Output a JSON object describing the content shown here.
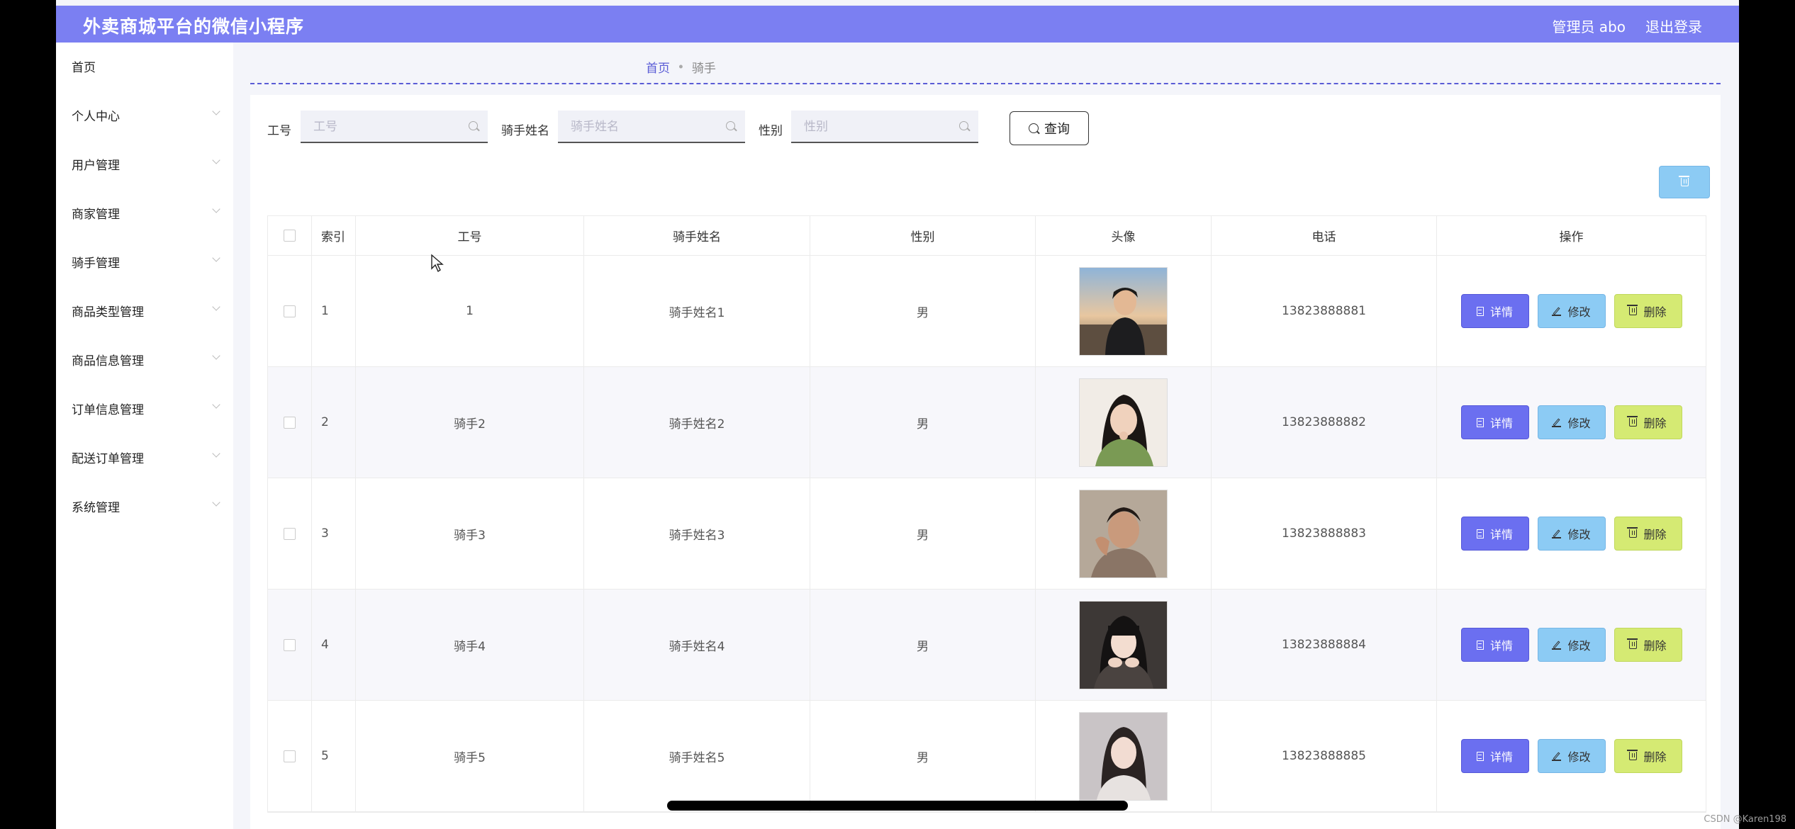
{
  "header": {
    "title": "外卖商城平台的微信小程序",
    "user": "管理员 abo",
    "logout": "退出登录"
  },
  "sidebar": {
    "items": [
      {
        "label": "首页",
        "has_children": false
      },
      {
        "label": "个人中心",
        "has_children": true
      },
      {
        "label": "用户管理",
        "has_children": true
      },
      {
        "label": "商家管理",
        "has_children": true
      },
      {
        "label": "骑手管理",
        "has_children": true
      },
      {
        "label": "商品类型管理",
        "has_children": true
      },
      {
        "label": "商品信息管理",
        "has_children": true
      },
      {
        "label": "订单信息管理",
        "has_children": true
      },
      {
        "label": "配送订单管理",
        "has_children": true
      },
      {
        "label": "系统管理",
        "has_children": true
      }
    ]
  },
  "breadcrumb": {
    "home": "首页",
    "current": "骑手"
  },
  "search": {
    "id_label": "工号",
    "id_placeholder": "工号",
    "name_label": "骑手姓名",
    "name_placeholder": "骑手姓名",
    "gender_label": "性别",
    "gender_placeholder": "性别",
    "query_label": "查询"
  },
  "table": {
    "headers": [
      "索引",
      "工号",
      "骑手姓名",
      "性别",
      "头像",
      "电话",
      "操作"
    ],
    "rows": [
      {
        "index": "1",
        "id": "1",
        "name": "骑手姓名1",
        "gender": "男",
        "phone": "13823888881"
      },
      {
        "index": "2",
        "id": "骑手2",
        "name": "骑手姓名2",
        "gender": "男",
        "phone": "13823888882"
      },
      {
        "index": "3",
        "id": "骑手3",
        "name": "骑手姓名3",
        "gender": "男",
        "phone": "13823888883"
      },
      {
        "index": "4",
        "id": "骑手4",
        "name": "骑手姓名4",
        "gender": "男",
        "phone": "13823888884"
      },
      {
        "index": "5",
        "id": "骑手5",
        "name": "骑手姓名5",
        "gender": "男",
        "phone": "13823888885"
      }
    ],
    "actions": {
      "detail": "详情",
      "edit": "修改",
      "delete": "删除"
    }
  },
  "watermark": "CSDN @Karen198",
  "colors": {
    "header": "#7b7ff2",
    "detail_button": "#6b6ff0",
    "edit_button": "#8ccbf4",
    "delete_button": "#d5ea73",
    "accent": "#5a5cd6"
  }
}
